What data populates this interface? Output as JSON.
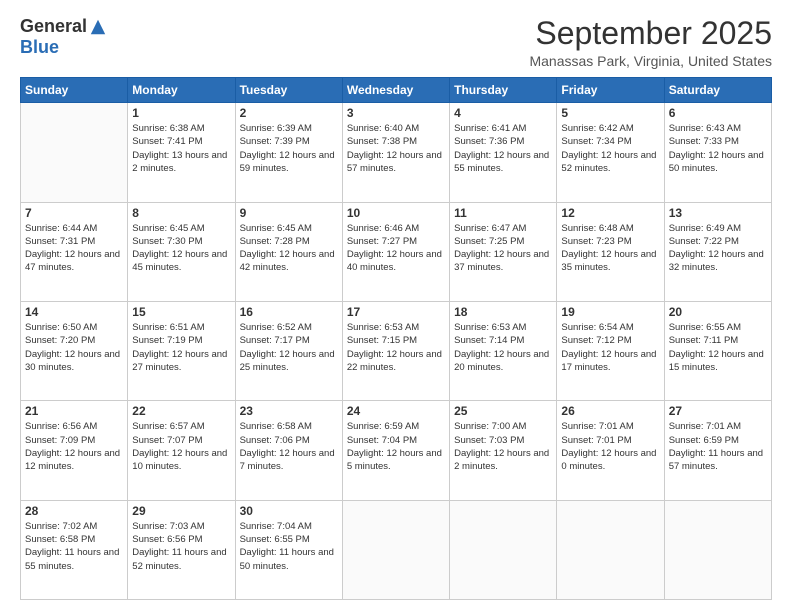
{
  "header": {
    "logo_general": "General",
    "logo_blue": "Blue",
    "month": "September 2025",
    "location": "Manassas Park, Virginia, United States"
  },
  "days_of_week": [
    "Sunday",
    "Monday",
    "Tuesday",
    "Wednesday",
    "Thursday",
    "Friday",
    "Saturday"
  ],
  "weeks": [
    [
      {
        "day": "",
        "sunrise": "",
        "sunset": "",
        "daylight": ""
      },
      {
        "day": "1",
        "sunrise": "Sunrise: 6:38 AM",
        "sunset": "Sunset: 7:41 PM",
        "daylight": "Daylight: 13 hours and 2 minutes."
      },
      {
        "day": "2",
        "sunrise": "Sunrise: 6:39 AM",
        "sunset": "Sunset: 7:39 PM",
        "daylight": "Daylight: 12 hours and 59 minutes."
      },
      {
        "day": "3",
        "sunrise": "Sunrise: 6:40 AM",
        "sunset": "Sunset: 7:38 PM",
        "daylight": "Daylight: 12 hours and 57 minutes."
      },
      {
        "day": "4",
        "sunrise": "Sunrise: 6:41 AM",
        "sunset": "Sunset: 7:36 PM",
        "daylight": "Daylight: 12 hours and 55 minutes."
      },
      {
        "day": "5",
        "sunrise": "Sunrise: 6:42 AM",
        "sunset": "Sunset: 7:34 PM",
        "daylight": "Daylight: 12 hours and 52 minutes."
      },
      {
        "day": "6",
        "sunrise": "Sunrise: 6:43 AM",
        "sunset": "Sunset: 7:33 PM",
        "daylight": "Daylight: 12 hours and 50 minutes."
      }
    ],
    [
      {
        "day": "7",
        "sunrise": "Sunrise: 6:44 AM",
        "sunset": "Sunset: 7:31 PM",
        "daylight": "Daylight: 12 hours and 47 minutes."
      },
      {
        "day": "8",
        "sunrise": "Sunrise: 6:45 AM",
        "sunset": "Sunset: 7:30 PM",
        "daylight": "Daylight: 12 hours and 45 minutes."
      },
      {
        "day": "9",
        "sunrise": "Sunrise: 6:45 AM",
        "sunset": "Sunset: 7:28 PM",
        "daylight": "Daylight: 12 hours and 42 minutes."
      },
      {
        "day": "10",
        "sunrise": "Sunrise: 6:46 AM",
        "sunset": "Sunset: 7:27 PM",
        "daylight": "Daylight: 12 hours and 40 minutes."
      },
      {
        "day": "11",
        "sunrise": "Sunrise: 6:47 AM",
        "sunset": "Sunset: 7:25 PM",
        "daylight": "Daylight: 12 hours and 37 minutes."
      },
      {
        "day": "12",
        "sunrise": "Sunrise: 6:48 AM",
        "sunset": "Sunset: 7:23 PM",
        "daylight": "Daylight: 12 hours and 35 minutes."
      },
      {
        "day": "13",
        "sunrise": "Sunrise: 6:49 AM",
        "sunset": "Sunset: 7:22 PM",
        "daylight": "Daylight: 12 hours and 32 minutes."
      }
    ],
    [
      {
        "day": "14",
        "sunrise": "Sunrise: 6:50 AM",
        "sunset": "Sunset: 7:20 PM",
        "daylight": "Daylight: 12 hours and 30 minutes."
      },
      {
        "day": "15",
        "sunrise": "Sunrise: 6:51 AM",
        "sunset": "Sunset: 7:19 PM",
        "daylight": "Daylight: 12 hours and 27 minutes."
      },
      {
        "day": "16",
        "sunrise": "Sunrise: 6:52 AM",
        "sunset": "Sunset: 7:17 PM",
        "daylight": "Daylight: 12 hours and 25 minutes."
      },
      {
        "day": "17",
        "sunrise": "Sunrise: 6:53 AM",
        "sunset": "Sunset: 7:15 PM",
        "daylight": "Daylight: 12 hours and 22 minutes."
      },
      {
        "day": "18",
        "sunrise": "Sunrise: 6:53 AM",
        "sunset": "Sunset: 7:14 PM",
        "daylight": "Daylight: 12 hours and 20 minutes."
      },
      {
        "day": "19",
        "sunrise": "Sunrise: 6:54 AM",
        "sunset": "Sunset: 7:12 PM",
        "daylight": "Daylight: 12 hours and 17 minutes."
      },
      {
        "day": "20",
        "sunrise": "Sunrise: 6:55 AM",
        "sunset": "Sunset: 7:11 PM",
        "daylight": "Daylight: 12 hours and 15 minutes."
      }
    ],
    [
      {
        "day": "21",
        "sunrise": "Sunrise: 6:56 AM",
        "sunset": "Sunset: 7:09 PM",
        "daylight": "Daylight: 12 hours and 12 minutes."
      },
      {
        "day": "22",
        "sunrise": "Sunrise: 6:57 AM",
        "sunset": "Sunset: 7:07 PM",
        "daylight": "Daylight: 12 hours and 10 minutes."
      },
      {
        "day": "23",
        "sunrise": "Sunrise: 6:58 AM",
        "sunset": "Sunset: 7:06 PM",
        "daylight": "Daylight: 12 hours and 7 minutes."
      },
      {
        "day": "24",
        "sunrise": "Sunrise: 6:59 AM",
        "sunset": "Sunset: 7:04 PM",
        "daylight": "Daylight: 12 hours and 5 minutes."
      },
      {
        "day": "25",
        "sunrise": "Sunrise: 7:00 AM",
        "sunset": "Sunset: 7:03 PM",
        "daylight": "Daylight: 12 hours and 2 minutes."
      },
      {
        "day": "26",
        "sunrise": "Sunrise: 7:01 AM",
        "sunset": "Sunset: 7:01 PM",
        "daylight": "Daylight: 12 hours and 0 minutes."
      },
      {
        "day": "27",
        "sunrise": "Sunrise: 7:01 AM",
        "sunset": "Sunset: 6:59 PM",
        "daylight": "Daylight: 11 hours and 57 minutes."
      }
    ],
    [
      {
        "day": "28",
        "sunrise": "Sunrise: 7:02 AM",
        "sunset": "Sunset: 6:58 PM",
        "daylight": "Daylight: 11 hours and 55 minutes."
      },
      {
        "day": "29",
        "sunrise": "Sunrise: 7:03 AM",
        "sunset": "Sunset: 6:56 PM",
        "daylight": "Daylight: 11 hours and 52 minutes."
      },
      {
        "day": "30",
        "sunrise": "Sunrise: 7:04 AM",
        "sunset": "Sunset: 6:55 PM",
        "daylight": "Daylight: 11 hours and 50 minutes."
      },
      {
        "day": "",
        "sunrise": "",
        "sunset": "",
        "daylight": ""
      },
      {
        "day": "",
        "sunrise": "",
        "sunset": "",
        "daylight": ""
      },
      {
        "day": "",
        "sunrise": "",
        "sunset": "",
        "daylight": ""
      },
      {
        "day": "",
        "sunrise": "",
        "sunset": "",
        "daylight": ""
      }
    ]
  ]
}
